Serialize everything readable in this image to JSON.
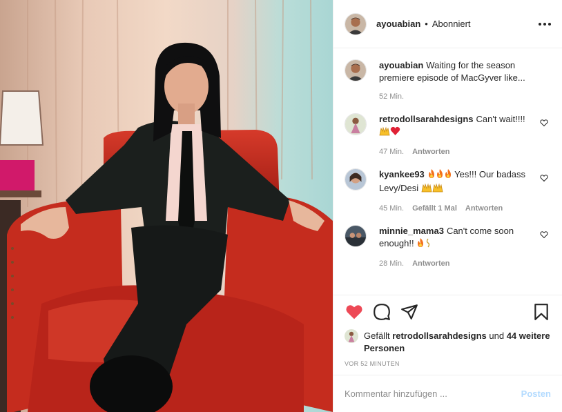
{
  "post": {
    "author": "ayouabian",
    "follow_status": "Abonniert",
    "separator": "•",
    "caption": {
      "user": "ayouabian",
      "text": "Waiting for the season premiere episode of MacGyver like...",
      "time": "52 Min."
    },
    "comments": [
      {
        "user": "retrodollsarahdesigns",
        "text": "Can't wait!!!!",
        "emojis": [
          "raising-hands",
          "red-heart"
        ],
        "time": "47 Min.",
        "likes": "",
        "reply": "Antworten"
      },
      {
        "user": "kyankee93",
        "text_pre_emojis": [
          "fire",
          "fire",
          "fire"
        ],
        "text": "Yes!!! Our badass Levy/Desi",
        "emojis": [
          "raising-hands",
          "raising-hands"
        ],
        "time": "45 Min.",
        "likes": "Gefällt 1 Mal",
        "reply": "Antworten"
      },
      {
        "user": "minnie_mama3",
        "text": "Can't come soon enough!!",
        "emojis": [
          "fire",
          "sparkle"
        ],
        "time": "28 Min.",
        "likes": "",
        "reply": "Antworten"
      }
    ],
    "likes": {
      "prefix": "Gefällt",
      "user": "retrodollsarahdesigns",
      "middle": "und",
      "others": "44 weitere Personen"
    },
    "time_ago": "VOR 52 MINUTEN",
    "comment_input": {
      "placeholder": "Kommentar hinzufügen ...",
      "submit_label": "Posten"
    },
    "colors": {
      "like_red": "#ed4956",
      "post_button_disabled": "#b3dbff",
      "meta_gray": "#8e8e8e"
    }
  }
}
